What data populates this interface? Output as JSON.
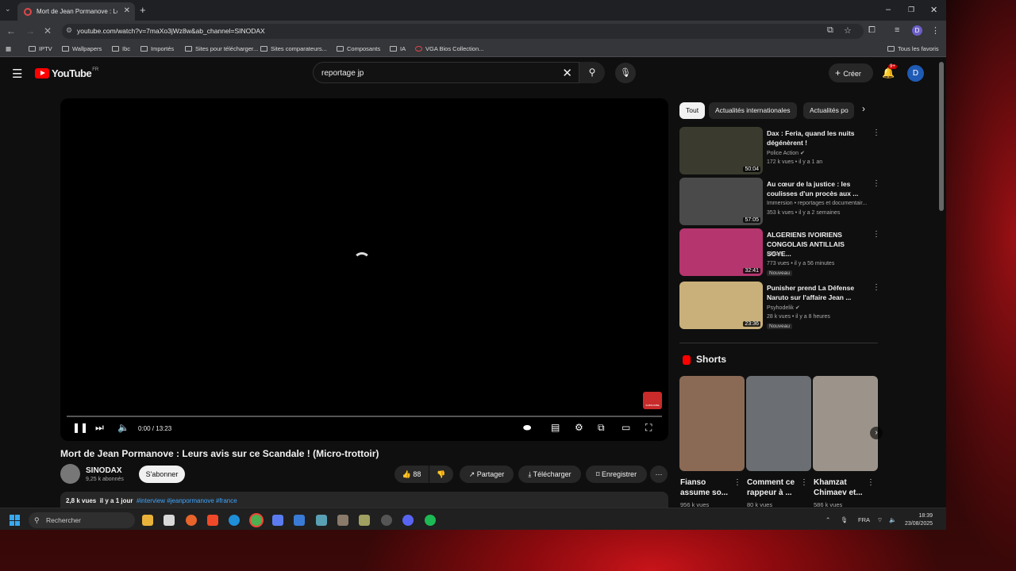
{
  "browser": {
    "tab_title": "Mort de Jean Pormanove : Leur",
    "url": "youtube.com/watch?v=7maXo3jWz8w&ab_channel=SINODAX",
    "bookmarks": [
      "IPTV",
      "Wallpapers",
      "Ibc",
      "Importés",
      "Sites pour télécharger...",
      "Sites comparateurs...",
      "Composants",
      "IA",
      "VGA Bios Collection..."
    ],
    "all_bookmarks": "Tous les favoris",
    "profile_initial": "D"
  },
  "header": {
    "logo_text": "YouTube",
    "logo_region": "FR",
    "search_value": "reportage jp",
    "create_label": "Créer",
    "notif_badge": "9+",
    "avatar_initial": "D"
  },
  "player": {
    "time": "0:00 / 13:23",
    "progress": 0
  },
  "video": {
    "title": "Mort de Jean Pormanove : Leurs avis sur ce Scandale ! (Micro-trottoir)",
    "channel": "SINODAX",
    "subscribers": "9,25 k abonnés",
    "subscribe_label": "S'abonner",
    "likes": "88",
    "share_label": "Partager",
    "download_label": "Télécharger",
    "save_label": "Enregistrer",
    "views": "2,8 k vues",
    "date": "il y a 1 jour",
    "hashtags": "#interview #jeanpormanove #france"
  },
  "chips": [
    "Tout",
    "Actualités internationales",
    "Actualités po"
  ],
  "related": [
    {
      "title": "Dax : Feria, quand les nuits dégénèrent !",
      "channel": "Police Action",
      "meta": "172 k vues • il y a 1 an",
      "duration": "50:04",
      "badge": "",
      "color": "#3a3a2e"
    },
    {
      "title": "Au cœur de la justice : les coulisses d'un procès aux ...",
      "channel": "Immersion • reportages et documentair...",
      "meta": "353 k vues • il y a 2 semaines",
      "duration": "57:05",
      "badge": "",
      "color": "#4a4a4a"
    },
    {
      "title": "ALGERIENS IVOIRIENS CONGOLAIS ANTILLAIS SOYE...",
      "channel": "Blaize",
      "meta": "773 vues • il y a 56 minutes",
      "duration": "32:41",
      "badge": "Nouveau",
      "color": "#b5356e"
    },
    {
      "title": "Punisher prend La Défense Naruto sur l'affaire Jean ...",
      "channel": "Psyhodelik",
      "meta": "28 k vues • il y a 8 heures",
      "duration": "23:36",
      "badge": "Nouveau",
      "color": "#c9b07a"
    }
  ],
  "shorts": {
    "heading": "Shorts",
    "items": [
      {
        "title": "Fianso assume so...",
        "views": "956 k vues",
        "color": "#8a6a55"
      },
      {
        "title": "Comment ce rappeur à ...",
        "views": "80 k vues",
        "color": "#6b6f73"
      },
      {
        "title": "Khamzat Chimaev et...",
        "views": "586 k vues",
        "color": "#9c948a"
      }
    ]
  },
  "taskbar": {
    "search_label": "Rechercher",
    "lang": "FRA",
    "time": "18:39",
    "date": "23/08/2025"
  }
}
